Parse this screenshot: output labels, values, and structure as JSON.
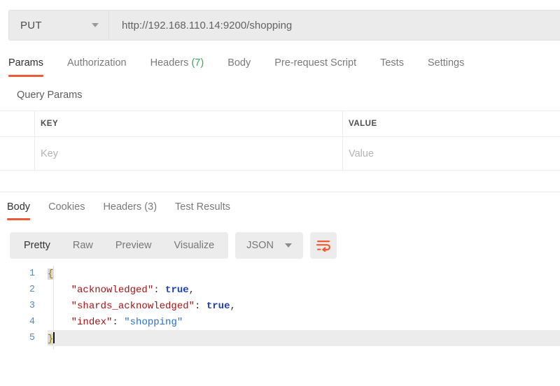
{
  "request": {
    "method": "PUT",
    "method_caret_icon": "chevron-down-icon",
    "url": "http://192.168.110.14:9200/shopping",
    "tabs": [
      {
        "label": "Params",
        "active": true,
        "count": ""
      },
      {
        "label": "Authorization",
        "active": false,
        "count": ""
      },
      {
        "label": "Headers",
        "active": false,
        "count": "(7)"
      },
      {
        "label": "Body",
        "active": false,
        "count": ""
      },
      {
        "label": "Pre-request Script",
        "active": false,
        "count": ""
      },
      {
        "label": "Tests",
        "active": false,
        "count": ""
      },
      {
        "label": "Settings",
        "active": false,
        "count": ""
      }
    ],
    "query_params": {
      "section_title": "Query Params",
      "columns": [
        "KEY",
        "VALUE"
      ],
      "rows": [
        {
          "key_placeholder": "Key",
          "value_placeholder": "Value"
        }
      ]
    }
  },
  "response": {
    "tabs": [
      {
        "label": "Body",
        "active": true,
        "count": ""
      },
      {
        "label": "Cookies",
        "active": false,
        "count": ""
      },
      {
        "label": "Headers",
        "active": false,
        "count": "(3)"
      },
      {
        "label": "Test Results",
        "active": false,
        "count": ""
      }
    ],
    "format_modes": [
      {
        "label": "Pretty",
        "active": true
      },
      {
        "label": "Raw",
        "active": false
      },
      {
        "label": "Preview",
        "active": false
      },
      {
        "label": "Visualize",
        "active": false
      }
    ],
    "language_select": {
      "value": "JSON",
      "caret_icon": "chevron-down-icon"
    },
    "wrap_button": {
      "icon": "word-wrap-icon"
    },
    "body_lines": [
      {
        "num": "1",
        "active": false
      },
      {
        "num": "2",
        "active": false
      },
      {
        "num": "3",
        "active": false
      },
      {
        "num": "4",
        "active": false
      },
      {
        "num": "5",
        "active": true
      }
    ],
    "body_tokens": {
      "line1_brace": "{",
      "line2_key": "\"acknowledged\"",
      "line2_colon": ": ",
      "line2_value": "true",
      "line2_comma": ",",
      "line3_key": "\"shards_acknowledged\"",
      "line3_colon": ": ",
      "line3_value": "true",
      "line3_comma": ",",
      "line4_key": "\"index\"",
      "line4_colon": ": ",
      "line4_value": "\"shopping\"",
      "line5_brace": "}"
    }
  },
  "colors": {
    "accent_orange": "#ef5b33",
    "count_green": "#3aa55d",
    "json_key": "#a31515",
    "json_bool": "#1d3fb5",
    "json_string": "#2a6fc9",
    "line_number": "#5a8bb8"
  }
}
